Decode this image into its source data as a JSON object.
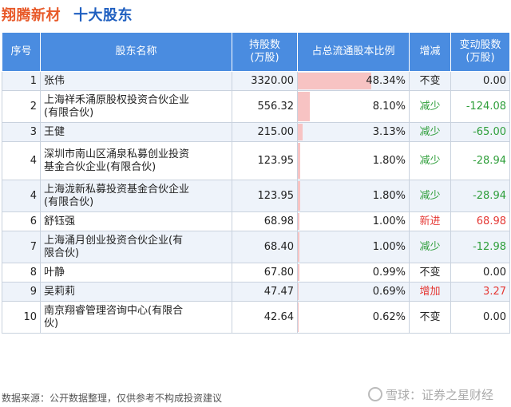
{
  "title": {
    "company": "翔腾新材",
    "section": "十大股东"
  },
  "columns": {
    "index": "序号",
    "name": "股东名称",
    "shares": "持股数\n(万股)",
    "ratio": "占总流通股本比例",
    "change_type": "增减",
    "change_amount": "变动股数\n(万股)"
  },
  "rows": [
    {
      "index": "1",
      "name": "张伟",
      "shares": "3320.00",
      "ratio": "48.34%",
      "ratio_value": 48.34,
      "change_type": "不变",
      "change_amount": "0.00",
      "dir": "flat"
    },
    {
      "index": "2",
      "name": "上海祥禾涌原股权投资合伙企业\n(有限合伙)",
      "shares": "556.32",
      "ratio": "8.10%",
      "ratio_value": 8.1,
      "change_type": "减少",
      "change_amount": "-124.08",
      "dir": "down"
    },
    {
      "index": "3",
      "name": "王健",
      "shares": "215.00",
      "ratio": "3.13%",
      "ratio_value": 3.13,
      "change_type": "减少",
      "change_amount": "-65.00",
      "dir": "down"
    },
    {
      "index": "4",
      "name": "深圳市南山区涌泉私募创业投资\n基金合伙企业(有限合伙)",
      "shares": "123.95",
      "ratio": "1.80%",
      "ratio_value": 1.8,
      "change_type": "减少",
      "change_amount": "-28.94",
      "dir": "down"
    },
    {
      "index": "4",
      "name": "上海泷新私募投资基金合伙企业\n(有限合伙)",
      "shares": "123.95",
      "ratio": "1.80%",
      "ratio_value": 1.8,
      "change_type": "减少",
      "change_amount": "-28.94",
      "dir": "down"
    },
    {
      "index": "6",
      "name": "舒钰强",
      "shares": "68.98",
      "ratio": "1.00%",
      "ratio_value": 1.0,
      "change_type": "新进",
      "change_amount": "68.98",
      "dir": "up"
    },
    {
      "index": "7",
      "name": "上海涌月创业投资合伙企业(有\n限合伙)",
      "shares": "68.40",
      "ratio": "1.00%",
      "ratio_value": 1.0,
      "change_type": "减少",
      "change_amount": "-12.98",
      "dir": "down"
    },
    {
      "index": "8",
      "name": "叶静",
      "shares": "67.80",
      "ratio": "0.99%",
      "ratio_value": 0.99,
      "change_type": "不变",
      "change_amount": "0.00",
      "dir": "flat"
    },
    {
      "index": "9",
      "name": "吴莉莉",
      "shares": "47.47",
      "ratio": "0.69%",
      "ratio_value": 0.69,
      "change_type": "增加",
      "change_amount": "3.27",
      "dir": "up"
    },
    {
      "index": "10",
      "name": "南京翔睿管理咨询中心(有限合\n伙)",
      "shares": "42.64",
      "ratio": "0.62%",
      "ratio_value": 0.62,
      "change_type": "不变",
      "change_amount": "0.00",
      "dir": "flat"
    }
  ],
  "footer": {
    "note": "数据来源：公开数据整理，仅供参考不构成投资建议",
    "brand": "雪球：证券之星财经"
  },
  "colors": {
    "header_bg": "#4a8ce0",
    "down": "#2e9e3a",
    "up": "#e53935",
    "bar": "#f7c3c3"
  }
}
